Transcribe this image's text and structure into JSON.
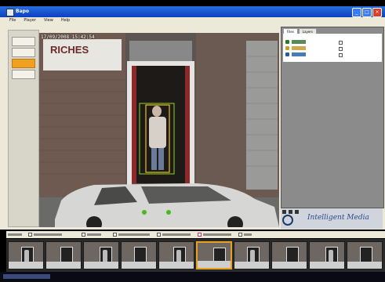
{
  "window": {
    "title": "Bapo"
  },
  "menubar": {
    "items": [
      "File",
      "Player",
      "View",
      "Help"
    ]
  },
  "video": {
    "timestamp": "17/09/2008 15:42:54",
    "sign_text": "RICHES"
  },
  "panel": {
    "tabs": [
      "Files",
      "Layers"
    ],
    "tracks": [
      {
        "color": "#2a7a2a"
      },
      {
        "color": "#c8a020"
      },
      {
        "color": "#2a5aa0"
      }
    ]
  },
  "logo": {
    "text": "Intelligent Media"
  },
  "filmstrip": {
    "thumb_count": 10,
    "selected_index": 5
  }
}
